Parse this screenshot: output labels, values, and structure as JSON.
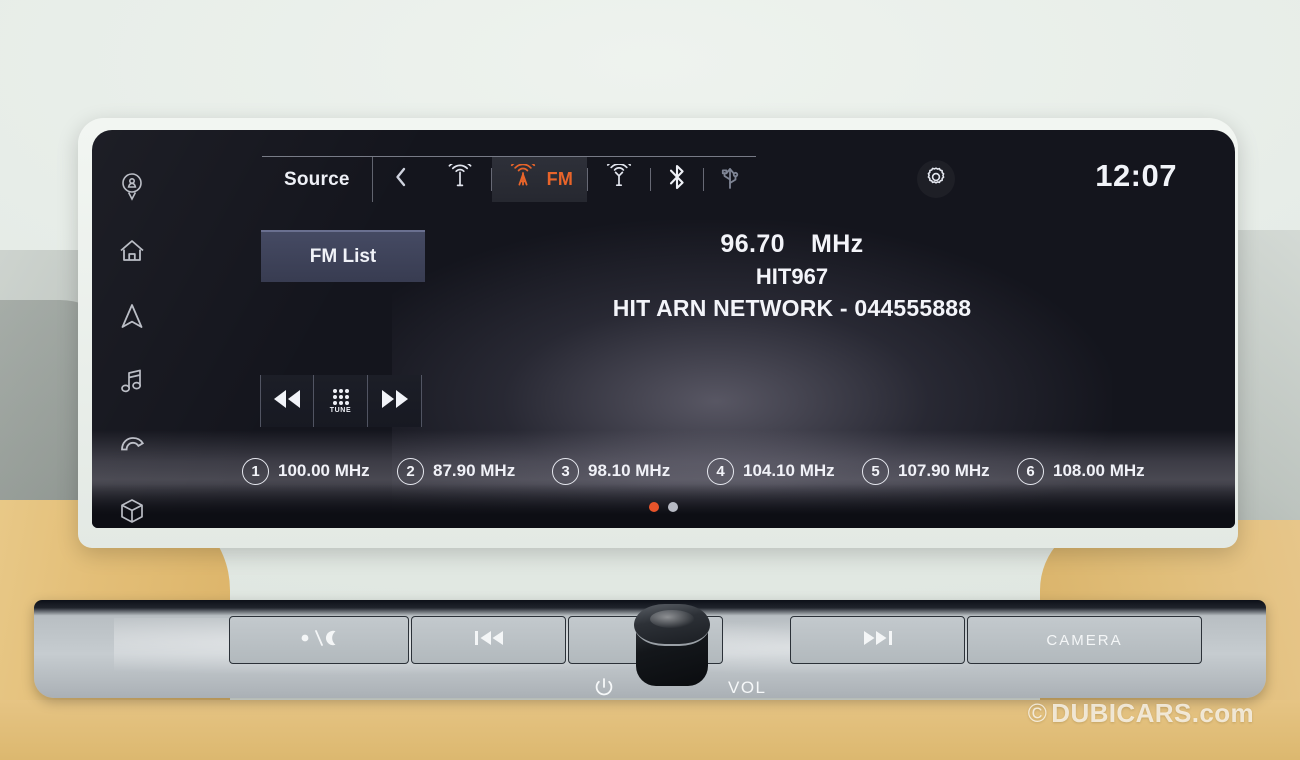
{
  "meta": {
    "device": "car-infotainment-head-unit",
    "watermark_symbol": "©",
    "watermark_text": "DUBICARS.com"
  },
  "colors": {
    "accent_orange": "#e8642a",
    "page_dot_active": "#e8542a",
    "screen_bg": "#14151d",
    "text_primary": "#f2f3f8",
    "fmlist_fill": "#3e4359",
    "dashboard_beige": "#e3be77",
    "panel_silver": "#c0c6ca"
  },
  "sidebar": {
    "items": [
      {
        "name": "profile-pin-icon",
        "label": "Profile"
      },
      {
        "name": "home-icon",
        "label": "Home"
      },
      {
        "name": "navigation-arrow-icon",
        "label": "Navigation"
      },
      {
        "name": "music-note-icon",
        "label": "Audio"
      },
      {
        "name": "phone-icon",
        "label": "Phone"
      },
      {
        "name": "apps-cube-icon",
        "label": "Apps"
      }
    ]
  },
  "topbar": {
    "source_label": "Source",
    "back_icon": "chevron-left-icon",
    "settings_icon": "gear-icon",
    "clock": "12:07",
    "tabs": [
      {
        "name": "tab-am-radio",
        "icon": "am-radio-tower-icon",
        "label": "",
        "active": false
      },
      {
        "name": "tab-fm-radio",
        "icon": "fm-radio-tower-icon",
        "label": "FM",
        "active": true
      },
      {
        "name": "tab-dab-radio",
        "icon": "dab-antenna-icon",
        "label": "",
        "active": false
      },
      {
        "name": "tab-bluetooth",
        "icon": "bluetooth-icon",
        "label": "",
        "active": false
      },
      {
        "name": "tab-usb",
        "icon": "usb-icon",
        "label": "",
        "active": false
      }
    ]
  },
  "main": {
    "fm_list_label": "FM List",
    "station": {
      "frequency": "96.70",
      "unit": "MHz",
      "name": "HIT967",
      "radio_text": "HIT ARN NETWORK - 044555888"
    },
    "transport": [
      {
        "name": "seek-back-button",
        "icon": "rewind-icon",
        "label": ""
      },
      {
        "name": "tune-button",
        "icon": "keypad-icon",
        "label": "TUNE"
      },
      {
        "name": "seek-forward-button",
        "icon": "fast-forward-icon",
        "label": ""
      }
    ],
    "presets": [
      {
        "number": "1",
        "frequency": "100.00 MHz"
      },
      {
        "number": "2",
        "frequency": "87.90 MHz"
      },
      {
        "number": "3",
        "frequency": "98.10 MHz"
      },
      {
        "number": "4",
        "frequency": "104.10 MHz"
      },
      {
        "number": "5",
        "frequency": "107.90 MHz"
      },
      {
        "number": "6",
        "frequency": "108.00 MHz"
      }
    ],
    "page_dots": {
      "total": 2,
      "active_index": 0
    }
  },
  "hardware": {
    "buttons": [
      {
        "name": "display-daynight-button",
        "icon": "sun-moon-icon",
        "label": ""
      },
      {
        "name": "previous-track-button",
        "icon": "skip-back-icon",
        "label": ""
      },
      {
        "name": "next-track-button",
        "icon": "skip-forward-icon",
        "label": ""
      },
      {
        "name": "camera-button",
        "icon": "",
        "label": "CAMERA"
      }
    ],
    "volume_knob": {
      "label": "VOL",
      "power_icon": "power-icon"
    }
  }
}
